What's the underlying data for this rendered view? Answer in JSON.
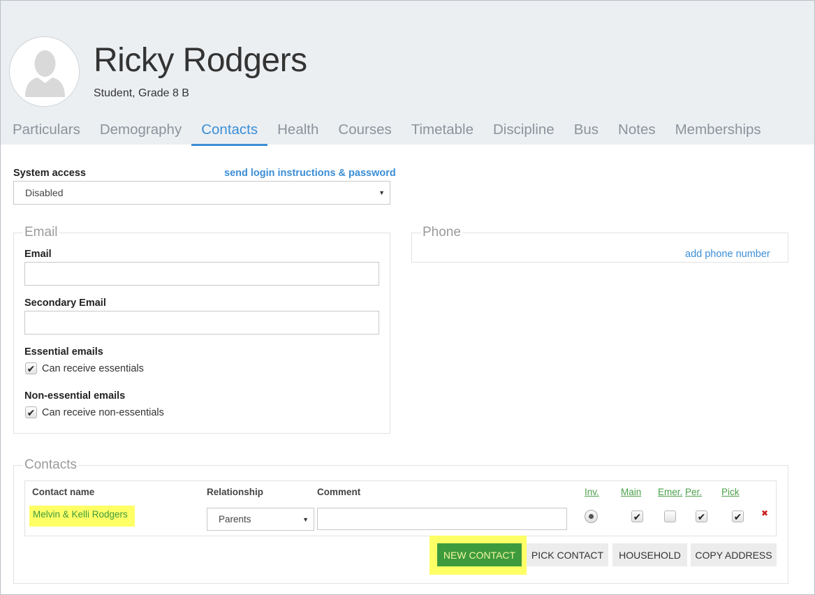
{
  "profile": {
    "name": "Ricky Rodgers",
    "subtitle": "Student, Grade 8 B"
  },
  "tabs": [
    {
      "label": "Particulars",
      "active": false
    },
    {
      "label": "Demography",
      "active": false
    },
    {
      "label": "Contacts",
      "active": true
    },
    {
      "label": "Health",
      "active": false
    },
    {
      "label": "Courses",
      "active": false
    },
    {
      "label": "Timetable",
      "active": false
    },
    {
      "label": "Discipline",
      "active": false
    },
    {
      "label": "Bus",
      "active": false
    },
    {
      "label": "Notes",
      "active": false
    },
    {
      "label": "Memberships",
      "active": false
    }
  ],
  "system_access": {
    "label": "System access",
    "link": "send login instructions & password",
    "value": "Disabled"
  },
  "email_panel": {
    "legend": "Email",
    "email_label": "Email",
    "email_value": "",
    "secondary_label": "Secondary Email",
    "secondary_value": "",
    "essential_label": "Essential emails",
    "essential_checkbox": "Can receive essentials",
    "essential_checked": true,
    "nonessential_label": "Non-essential emails",
    "nonessential_checkbox": "Can receive non-essentials",
    "nonessential_checked": true
  },
  "phone_panel": {
    "legend": "Phone",
    "add_link": "add phone number"
  },
  "contacts_panel": {
    "legend": "Contacts",
    "columns": {
      "name": "Contact name",
      "relationship": "Relationship",
      "comment": "Comment",
      "inv": "Inv.",
      "main": "Main",
      "emer": "Emer.",
      "per": "Per.",
      "pick": "Pick"
    },
    "rows": [
      {
        "name": "Melvin & Kelli Rodgers",
        "relationship": "Parents",
        "comment": "",
        "inv": true,
        "main": true,
        "emer": false,
        "per": true,
        "pick": true
      }
    ],
    "buttons": {
      "new_contact": "NEW CONTACT",
      "pick_contact": "PICK CONTACT",
      "household": "HOUSEHOLD",
      "copy_address": "COPY ADDRESS"
    }
  },
  "colors": {
    "accent": "#3b8ed6",
    "header_bg": "#eceff2",
    "green_button": "#3d9b3d",
    "highlight": "#ffff66",
    "delete": "#cc2222"
  }
}
